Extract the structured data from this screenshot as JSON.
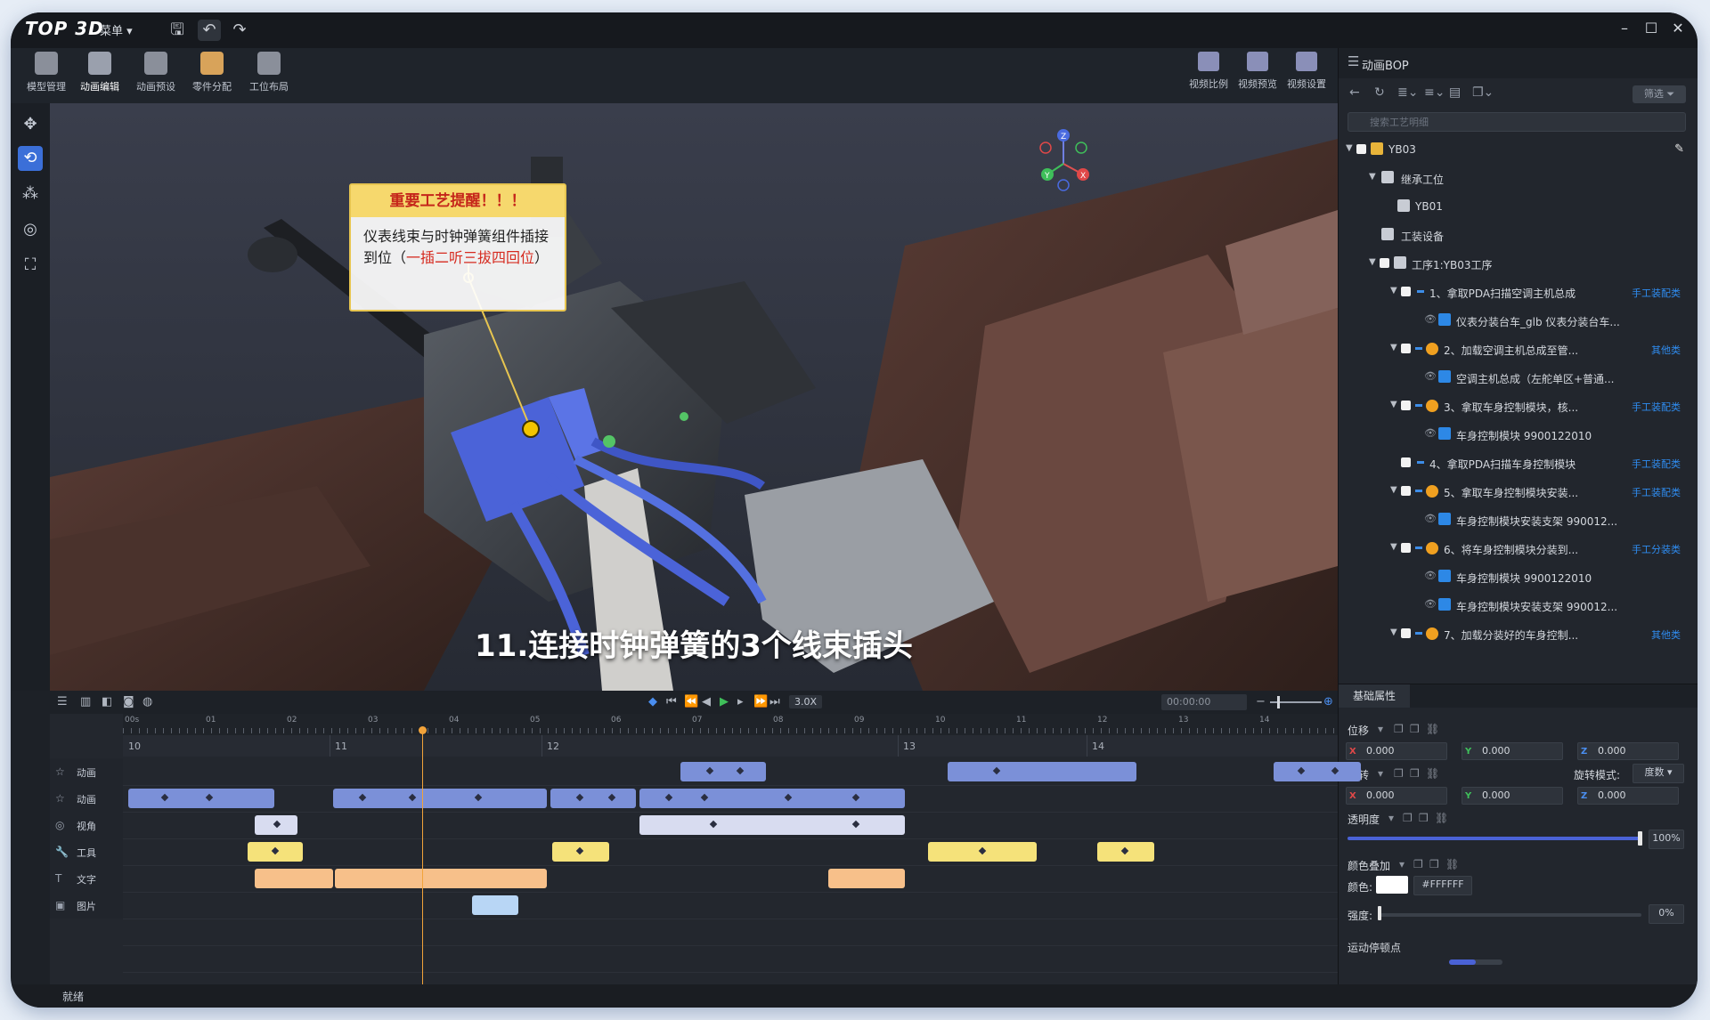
{
  "app": {
    "logo": "TOP 3D",
    "menu_label": "菜单 ▾"
  },
  "modules": [
    {
      "label": "模型管理"
    },
    {
      "label": "动画编辑"
    },
    {
      "label": "动画预设"
    },
    {
      "label": "零件分配"
    },
    {
      "label": "工位布局"
    }
  ],
  "right_modules": [
    {
      "label": "视频比例"
    },
    {
      "label": "视频预览"
    },
    {
      "label": "视频设置"
    }
  ],
  "viewport": {
    "callout_title": "重要工艺提醒！！！",
    "callout_text_a": "仪表线束与时钟弹簧组件插接到位（",
    "callout_text_hl": "一插二听三拔四回位",
    "callout_text_b": "）",
    "subtitle": "11.连接时钟弹簧的3个线束插头"
  },
  "panel": {
    "title": "动画BOP",
    "filter_label": "筛选",
    "search_placeholder": "搜索工艺明细",
    "tree": [
      {
        "label": "YB03",
        "tag": ""
      },
      {
        "label": "继承工位",
        "tag": ""
      },
      {
        "label": "YB01",
        "tag": ""
      },
      {
        "label": "工装设备",
        "tag": ""
      },
      {
        "label": "工序1:YB03工序",
        "tag": ""
      },
      {
        "label": "1、拿取PDA扫描空调主机总成",
        "tag": "手工装配类"
      },
      {
        "label": "仪表分装台车_glb 仪表分装台车...",
        "tag": ""
      },
      {
        "label": "2、加载空调主机总成至管...",
        "tag": "其他类"
      },
      {
        "label": "空调主机总成（左舵单区+普通...",
        "tag": ""
      },
      {
        "label": "3、拿取车身控制模块，核...",
        "tag": "手工装配类"
      },
      {
        "label": "车身控制模块 9900122010",
        "tag": ""
      },
      {
        "label": "4、拿取PDA扫描车身控制模块",
        "tag": "手工装配类"
      },
      {
        "label": "5、拿取车身控制模块安装...",
        "tag": "手工装配类"
      },
      {
        "label": "车身控制模块安装支架 990012...",
        "tag": ""
      },
      {
        "label": "6、将车身控制模块分装到...",
        "tag": "手工分装类"
      },
      {
        "label": "车身控制模块 9900122010",
        "tag": ""
      },
      {
        "label": "车身控制模块安装支架 990012...",
        "tag": ""
      },
      {
        "label": "7、加载分装好的车身控制...",
        "tag": "其他类"
      }
    ],
    "tab_label": "基础属性",
    "props": {
      "position_label": "位移",
      "rotation_label": "旋转",
      "rotation_mode_label": "旋转模式:",
      "rotation_mode_value": "度数",
      "opacity_label": "透明度",
      "opacity_value": "100%",
      "color_overlay_label": "颜色叠加",
      "color_label": "颜色:",
      "color_hex": "#FFFFFF",
      "strength_label": "强度:",
      "strength_value": "0%",
      "motion_label": "运动停顿点",
      "pos": {
        "x": "0.000",
        "y": "0.000",
        "z": "0.000"
      },
      "rot": {
        "x": "0.000",
        "y": "0.000",
        "z": "0.000"
      }
    }
  },
  "timeline": {
    "speed": "3.0X",
    "time": "00:00:00",
    "ruler_ticks": [
      "00s",
      "01",
      "02",
      "03",
      "04",
      "05",
      "06",
      "07",
      "08",
      "09",
      "10",
      "11",
      "12",
      "13",
      "14"
    ],
    "sections": [
      "10",
      "11",
      "12",
      "13",
      "14"
    ],
    "tracks": [
      {
        "label": "动画"
      },
      {
        "label": "动画"
      },
      {
        "label": "视角"
      },
      {
        "label": "工具"
      },
      {
        "label": "文字"
      },
      {
        "label": "图片"
      }
    ]
  },
  "status": "就绪",
  "colors": {
    "accent": "#3b6fd8",
    "clip_blue": "#7b90d8",
    "clip_light": "#d8dcf0",
    "clip_yellow": "#f5e27a",
    "clip_orange": "#f7c08a",
    "clip_sky": "#b8d6f5",
    "playhead": "#f2a33a",
    "tag_blue": "#2f8cf0"
  }
}
